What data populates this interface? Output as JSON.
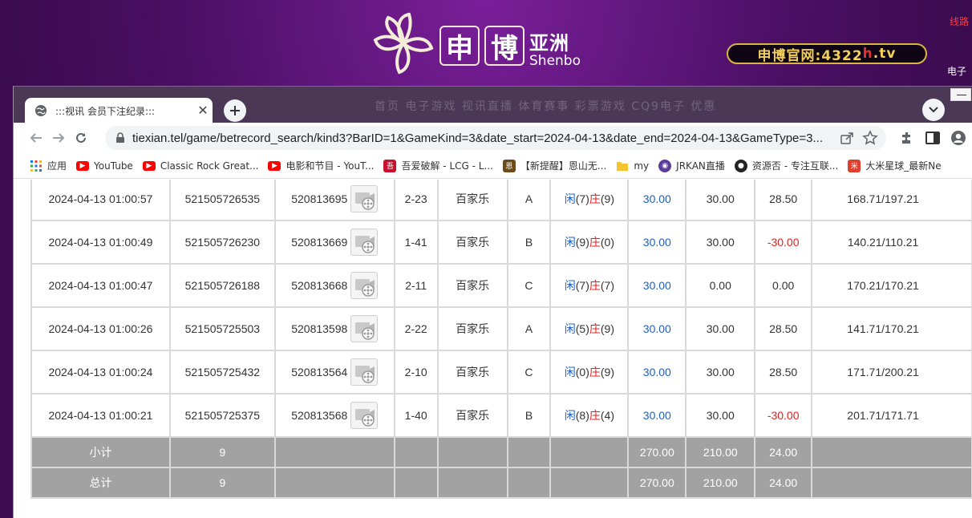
{
  "site": {
    "logo_box1": "申",
    "logo_box2": "博",
    "logo_asia": "亚洲",
    "logo_en": "Shenbo",
    "official_url_prefix": "申博官网:4322",
    "official_url_red": "h",
    "official_url_suffix": ".tv",
    "line_text": "线路",
    "ele_text": "电子",
    "faded_nav": "首页 电子游戏 视讯直播 体育赛事 彩票游戏 CQ9电子 优惠"
  },
  "browser": {
    "tab_title": ":::视讯 会员下注纪录:::",
    "url": "tiexian.tel/game/betrecord_search/kind3?BarID=1&GameKind=3&date_start=2024-04-13&date_end=2024-04-13&GameType=3...",
    "bookmarks": [
      {
        "label": "应用",
        "icon": "apps-grid-icon",
        "color": "#1a73e8"
      },
      {
        "label": "YouTube",
        "icon": "youtube-icon",
        "color": "#ff0000"
      },
      {
        "label": "Classic Rock Great...",
        "icon": "youtube-icon",
        "color": "#ff0000"
      },
      {
        "label": "电影和节目 - YouT...",
        "icon": "youtube-icon",
        "color": "#ff0000"
      },
      {
        "label": "吾爱破解 - LCG - L...",
        "icon": "52pojie-icon",
        "color": "#c8102e"
      },
      {
        "label": "【新提醒】恩山无...",
        "icon": "right-site-icon",
        "color": "#6b4b1a"
      },
      {
        "label": "my",
        "icon": "folder-icon",
        "color": "#f4c430"
      },
      {
        "label": "JRKAN直播",
        "icon": "jrkan-icon",
        "color": "#5a3e9a"
      },
      {
        "label": "资源否 - 专注互联...",
        "icon": "ziyuanfou-icon",
        "color": "#222222"
      },
      {
        "label": "大米星球_最新Ne",
        "icon": "dami-icon",
        "color": "#e03e2f"
      }
    ]
  },
  "records": [
    {
      "time": "2024-04-13 01:00:57",
      "order": "521505726535",
      "bet_id": "520813695",
      "round": "2-23",
      "game": "百家乐",
      "table": "A",
      "player_label": "闲",
      "player": "(7)",
      "banker_label": "庄",
      "banker": "(9)",
      "bet": "30.00",
      "valid": "30.00",
      "result": "28.50",
      "result_color": "normal",
      "balance": "168.71/197.21"
    },
    {
      "time": "2024-04-13 01:00:49",
      "order": "521505726230",
      "bet_id": "520813669",
      "round": "1-41",
      "game": "百家乐",
      "table": "B",
      "player_label": "闲",
      "player": "(9)",
      "banker_label": "庄",
      "banker": "(0)",
      "bet": "30.00",
      "valid": "30.00",
      "result": "-30.00",
      "result_color": "red",
      "balance": "140.21/110.21"
    },
    {
      "time": "2024-04-13 01:00:47",
      "order": "521505726188",
      "bet_id": "520813668",
      "round": "2-11",
      "game": "百家乐",
      "table": "C",
      "player_label": "闲",
      "player": "(7)",
      "banker_label": "庄",
      "banker": "(7)",
      "bet": "30.00",
      "valid": "0.00",
      "result": "0.00",
      "result_color": "normal",
      "balance": "170.21/170.21"
    },
    {
      "time": "2024-04-13 01:00:26",
      "order": "521505725503",
      "bet_id": "520813598",
      "round": "2-22",
      "game": "百家乐",
      "table": "A",
      "player_label": "闲",
      "player": "(5)",
      "banker_label": "庄",
      "banker": "(9)",
      "bet": "30.00",
      "valid": "30.00",
      "result": "28.50",
      "result_color": "normal",
      "balance": "141.71/170.21"
    },
    {
      "time": "2024-04-13 01:00:24",
      "order": "521505725432",
      "bet_id": "520813564",
      "round": "2-10",
      "game": "百家乐",
      "table": "C",
      "player_label": "闲",
      "player": "(0)",
      "banker_label": "庄",
      "banker": "(9)",
      "bet": "30.00",
      "valid": "30.00",
      "result": "28.50",
      "result_color": "normal",
      "balance": "171.71/200.21"
    },
    {
      "time": "2024-04-13 01:00:21",
      "order": "521505725375",
      "bet_id": "520813568",
      "round": "1-40",
      "game": "百家乐",
      "table": "B",
      "player_label": "闲",
      "player": "(8)",
      "banker_label": "庄",
      "banker": "(4)",
      "bet": "30.00",
      "valid": "30.00",
      "result": "-30.00",
      "result_color": "red",
      "balance": "201.71/171.71"
    }
  ],
  "subtotal": {
    "label": "小计",
    "count": "9",
    "bet": "270.00",
    "valid": "210.00",
    "result": "24.00"
  },
  "total": {
    "label": "总计",
    "count": "9",
    "bet": "270.00",
    "valid": "210.00",
    "result": "24.00"
  }
}
